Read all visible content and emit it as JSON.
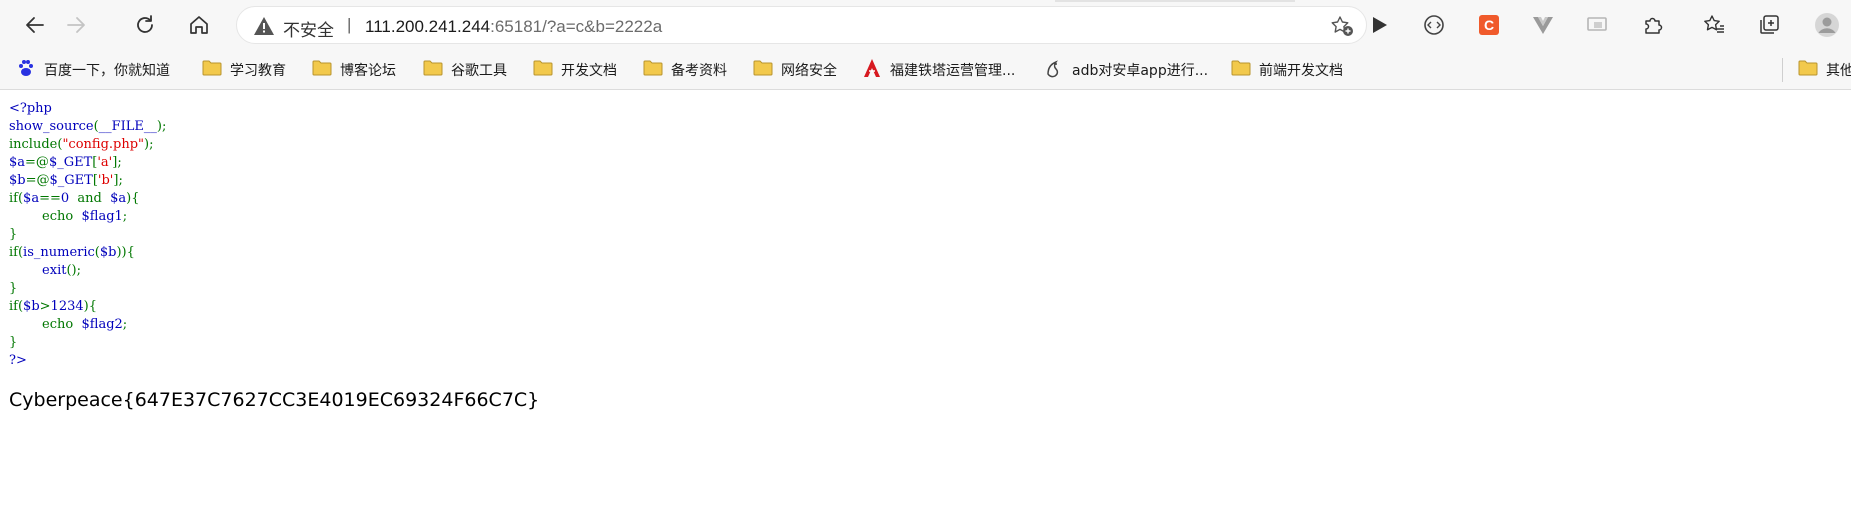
{
  "browser": {
    "address_bar": {
      "security_label": "不安全",
      "separator": "|",
      "url_host": "111.200.241.244",
      "url_rest": ":65181/?a=c&b=2222a"
    },
    "icons": {
      "back": "back-arrow-icon",
      "forward": "forward-arrow-icon",
      "reload": "reload-icon",
      "home": "home-icon",
      "favorite_add": "star-add-icon",
      "extension_play": "play-icon",
      "extension_code": "code-icon",
      "extension_c": "csdn-icon",
      "extension_v": "vue-icon",
      "extension_cast": "cast-icon",
      "extensions": "puzzle-icon",
      "favorites": "favorites-icon",
      "collections": "collections-icon",
      "profile": "profile-icon"
    },
    "bookmarks": [
      {
        "label": "百度一下，你就知道",
        "icon": "baidu-paw-icon"
      },
      {
        "label": "学习教育",
        "icon": "folder-icon"
      },
      {
        "label": "博客论坛",
        "icon": "folder-icon"
      },
      {
        "label": "谷歌工具",
        "icon": "folder-icon"
      },
      {
        "label": "开发文档",
        "icon": "folder-icon"
      },
      {
        "label": "备考资料",
        "icon": "folder-icon"
      },
      {
        "label": "网络安全",
        "icon": "folder-icon"
      },
      {
        "label": "福建铁塔运营管理...",
        "icon": "tower-logo-icon"
      },
      {
        "label": "adb对安卓app进行...",
        "icon": "bird-logo-icon"
      },
      {
        "label": "前端开发文档",
        "icon": "folder-icon"
      },
      {
        "label": "其他",
        "icon": "folder-icon"
      }
    ],
    "colors": {
      "chrome_bg": "#f7f7f7",
      "folder_yellow": "#f2c94c",
      "php_default": "#0000bb",
      "php_keyword": "#007700",
      "php_string": "#dd0000"
    }
  },
  "page": {
    "source_lines": [
      [
        {
          "t": "<?php",
          "c": "default"
        }
      ],
      [
        {
          "t": "show_source",
          "c": "default"
        },
        {
          "t": "(",
          "c": "keyword"
        },
        {
          "t": "__FILE__",
          "c": "default"
        },
        {
          "t": ");",
          "c": "keyword"
        }
      ],
      [
        {
          "t": "include(",
          "c": "keyword"
        },
        {
          "t": "\"config.php\"",
          "c": "string"
        },
        {
          "t": ");",
          "c": "keyword"
        }
      ],
      [
        {
          "t": "$a",
          "c": "default"
        },
        {
          "t": "=@",
          "c": "keyword"
        },
        {
          "t": "$_GET",
          "c": "default"
        },
        {
          "t": "[",
          "c": "keyword"
        },
        {
          "t": "'a'",
          "c": "string"
        },
        {
          "t": "];",
          "c": "keyword"
        }
      ],
      [
        {
          "t": "$b",
          "c": "default"
        },
        {
          "t": "=@",
          "c": "keyword"
        },
        {
          "t": "$_GET",
          "c": "default"
        },
        {
          "t": "[",
          "c": "keyword"
        },
        {
          "t": "'b'",
          "c": "string"
        },
        {
          "t": "];",
          "c": "keyword"
        }
      ],
      [
        {
          "t": "if(",
          "c": "keyword"
        },
        {
          "t": "$a",
          "c": "default"
        },
        {
          "t": "==",
          "c": "keyword"
        },
        {
          "t": "0 ",
          "c": "default"
        },
        {
          "t": " and ",
          "c": "keyword"
        },
        {
          "t": " $a",
          "c": "default"
        },
        {
          "t": "){",
          "c": "keyword"
        }
      ],
      [
        {
          "t": "        echo ",
          "c": "keyword"
        },
        {
          "t": " $flag1",
          "c": "default"
        },
        {
          "t": ";",
          "c": "keyword"
        }
      ],
      [
        {
          "t": "}",
          "c": "keyword"
        }
      ],
      [
        {
          "t": "if(",
          "c": "keyword"
        },
        {
          "t": "is_numeric",
          "c": "default"
        },
        {
          "t": "(",
          "c": "keyword"
        },
        {
          "t": "$b",
          "c": "default"
        },
        {
          "t": ")){",
          "c": "keyword"
        }
      ],
      [
        {
          "t": "        exit",
          "c": "default"
        },
        {
          "t": "();",
          "c": "keyword"
        }
      ],
      [
        {
          "t": "}",
          "c": "keyword"
        }
      ],
      [
        {
          "t": "if(",
          "c": "keyword"
        },
        {
          "t": "$b",
          "c": "default"
        },
        {
          "t": ">",
          "c": "keyword"
        },
        {
          "t": "1234",
          "c": "default"
        },
        {
          "t": "){",
          "c": "keyword"
        }
      ],
      [
        {
          "t": "        echo ",
          "c": "keyword"
        },
        {
          "t": " $flag2",
          "c": "default"
        },
        {
          "t": ";",
          "c": "keyword"
        }
      ],
      [
        {
          "t": "}",
          "c": "keyword"
        }
      ],
      [
        {
          "t": "?>",
          "c": "default"
        }
      ]
    ],
    "flag_output": "Cyberpeace{647E37C7627CC3E4019EC69324F66C7C}"
  }
}
